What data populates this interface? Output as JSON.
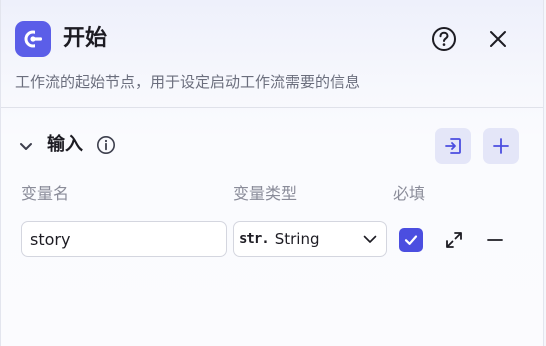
{
  "header": {
    "title": "开始",
    "description": "工作流的起始节点，用于设定启动工作流需要的信息",
    "node_icon": "start-node-icon",
    "help_icon": "question-circle-icon",
    "close_icon": "close-icon",
    "accent_color": "#5b5ee8"
  },
  "input_section": {
    "title": "输入",
    "info_icon": "info-circle-icon",
    "collapse_icon": "chevron-down-icon",
    "import_icon": "import-icon",
    "add_icon": "plus-icon",
    "columns": [
      "变量名",
      "变量类型",
      "必填"
    ],
    "rows": [
      {
        "name": "story",
        "type_glyph": "str.",
        "type": "String",
        "required": true
      }
    ]
  }
}
